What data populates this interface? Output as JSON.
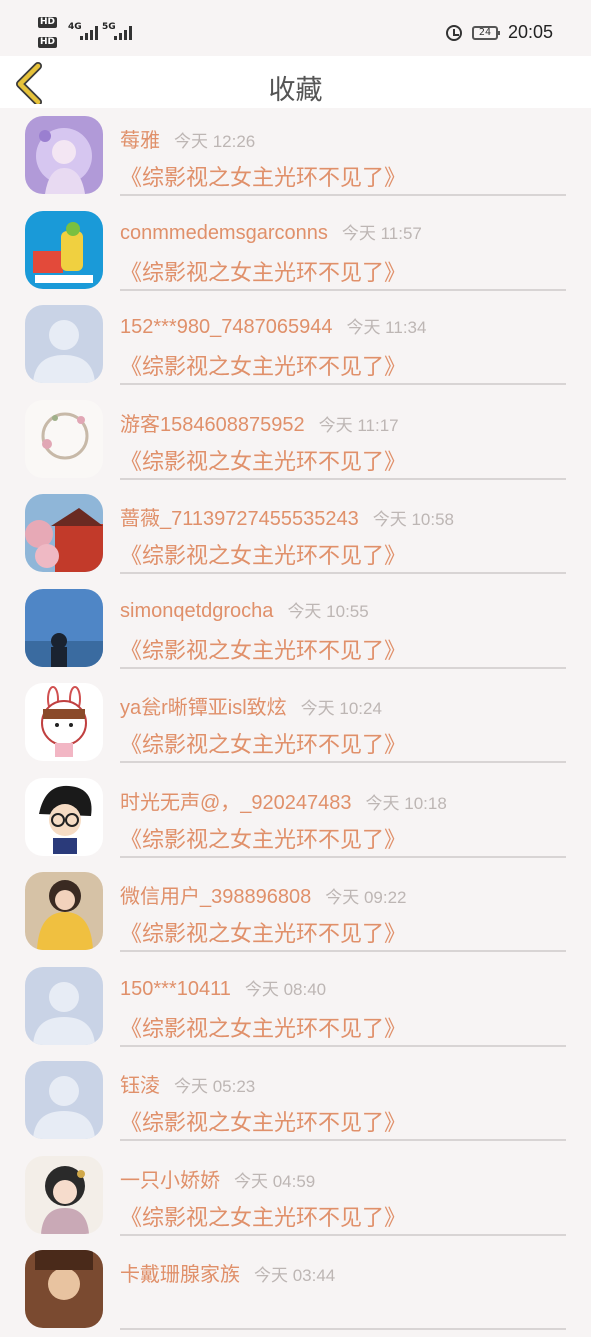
{
  "status": {
    "hd1": "HD",
    "hd2": "HD",
    "net1": "4G",
    "net2": "5G",
    "battery": "24",
    "time": "20:05"
  },
  "header": {
    "title": "收藏"
  },
  "items": [
    {
      "name": "莓雅",
      "time": "今天 12:26",
      "book": "《综影视之女主光环不见了》",
      "avatar": "anime-girl"
    },
    {
      "name": "conmmedemsgarconns",
      "time": "今天 11:57",
      "book": "《综影视之女主光环不见了》",
      "avatar": "cartoon"
    },
    {
      "name": "152***980_7487065944",
      "time": "今天 11:34",
      "book": "《综影视之女主光环不见了》",
      "avatar": "default"
    },
    {
      "name": "游客1584608875952",
      "time": "今天 11:17",
      "book": "《综影视之女主光环不见了》",
      "avatar": "wreath"
    },
    {
      "name": "蔷薇_71139727455535243",
      "time": "今天 10:58",
      "book": "《综影视之女主光环不见了》",
      "avatar": "temple"
    },
    {
      "name": "simonqetdgrocha",
      "time": "今天 10:55",
      "book": "《综影视之女主光环不见了》",
      "avatar": "sky"
    },
    {
      "name": "ya瓮r晰镡亚isl致炫",
      "time": "今天 10:24",
      "book": "《综影视之女主光环不见了》",
      "avatar": "bunny"
    },
    {
      "name": "时光无声@，_920247483",
      "time": "今天 10:18",
      "book": "《综影视之女主光环不见了》",
      "avatar": "conan"
    },
    {
      "name": "微信用户_398896808",
      "time": "今天 09:22",
      "book": "《综影视之女主光环不见了》",
      "avatar": "girl-yellow"
    },
    {
      "name": "150***10411",
      "time": "今天 08:40",
      "book": "《综影视之女主光环不见了》",
      "avatar": "default"
    },
    {
      "name": "钰淩",
      "time": "今天 05:23",
      "book": "《综影视之女主光环不见了》",
      "avatar": "default"
    },
    {
      "name": "一只小娇娇",
      "time": "今天 04:59",
      "book": "《综影视之女主光环不见了》",
      "avatar": "painted-girl"
    },
    {
      "name": "卡戴珊腺家族",
      "time": "今天 03:44",
      "book": "",
      "avatar": "default-warm"
    }
  ],
  "colors": {
    "accent": "#e0906a",
    "back_arrow": "#e6c23a",
    "time_grey": "#bdb6b4"
  }
}
